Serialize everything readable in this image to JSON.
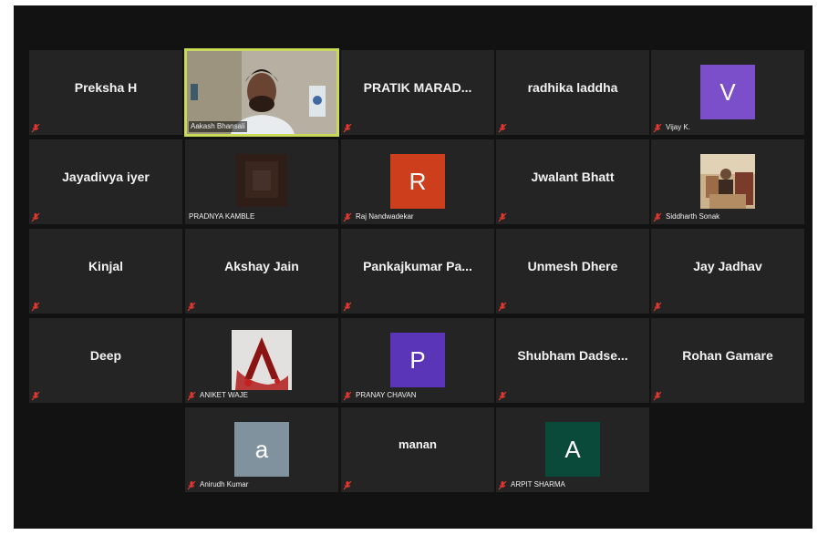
{
  "meeting": {
    "participants": [
      {
        "name": "Preksha H",
        "display": "name",
        "muted": true
      },
      {
        "name": "Aakash Bhansali",
        "display": "video",
        "muted": false,
        "speaking": true
      },
      {
        "name": "PRATIK  MARAD...",
        "display": "name",
        "muted": true
      },
      {
        "name": "radhika laddha",
        "display": "name",
        "muted": true
      },
      {
        "name": "Vijay K.",
        "display": "avatar",
        "initial": "V",
        "color": "#7b4fc9",
        "muted": true
      },
      {
        "name": "Jayadivya iyer",
        "display": "name",
        "muted": true
      },
      {
        "name": "PRADNYA KAMBLE",
        "display": "photo",
        "muted": false
      },
      {
        "name": "Raj Nandwadekar",
        "display": "avatar",
        "initial": "R",
        "color": "#cc3e1c",
        "muted": true
      },
      {
        "name": "Jwalant Bhatt",
        "display": "name",
        "muted": true
      },
      {
        "name": "Siddharth Sonak",
        "display": "photo",
        "muted": true
      },
      {
        "name": "Kinjal",
        "display": "name",
        "muted": true
      },
      {
        "name": "Akshay Jain",
        "display": "name",
        "muted": true
      },
      {
        "name": "Pankajkumar  Pa...",
        "display": "name",
        "muted": true
      },
      {
        "name": "Unmesh Dhere",
        "display": "name",
        "muted": true
      },
      {
        "name": "Jay Jadhav",
        "display": "name",
        "muted": true
      },
      {
        "name": "Deep",
        "display": "name",
        "muted": true
      },
      {
        "name": "ANIKET WAJE",
        "display": "photo",
        "muted": true
      },
      {
        "name": "PRANAY CHAVAN",
        "display": "avatar",
        "initial": "P",
        "color": "#5a35b8",
        "muted": true
      },
      {
        "name": "Shubham  Dadse...",
        "display": "name",
        "muted": true
      },
      {
        "name": "Rohan Gamare",
        "display": "name",
        "muted": true
      },
      {
        "name": "Anirudh Kumar",
        "display": "avatar",
        "initial": "a",
        "color": "#7f929d",
        "muted": true
      },
      {
        "name": "manan",
        "display": "name",
        "muted": true
      },
      {
        "name": "ARPIT SHARMA",
        "display": "avatar",
        "initial": "A",
        "color": "#0a4a3a",
        "muted": true
      }
    ]
  }
}
